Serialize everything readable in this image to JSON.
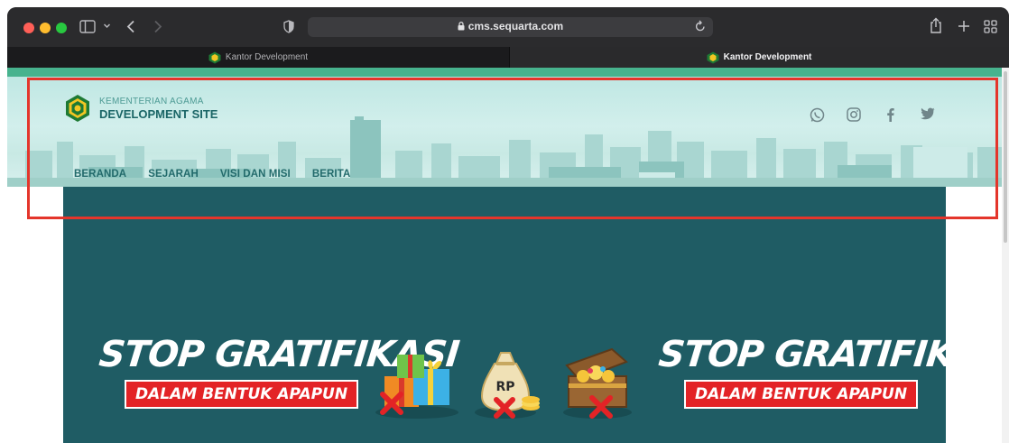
{
  "browser": {
    "url": "cms.sequarta.com",
    "tabs": [
      {
        "label": "Kantor Development"
      },
      {
        "label": "Kantor Development"
      }
    ]
  },
  "site": {
    "logo_subtitle": "KEMENTERIAN AGAMA",
    "logo_title": "DEVELOPMENT SITE",
    "nav": [
      {
        "label": "BERANDA"
      },
      {
        "label": "SEJARAH"
      },
      {
        "label": "VISI DAN MISI"
      },
      {
        "label": "BERITA"
      }
    ],
    "social": [
      "whatsapp-icon",
      "instagram-icon",
      "facebook-icon",
      "twitter-icon"
    ]
  },
  "banner": {
    "title": "STOP GRATIFIKASI",
    "subtitle": "DALAM BENTUK APAPUN",
    "money_bag_label": "RP",
    "background": "#1f5c64"
  },
  "colors": {
    "accent": "#47b38e",
    "nav_text": "#226a6b",
    "highlight": "#e4352b",
    "badge_red": "#e32326"
  }
}
